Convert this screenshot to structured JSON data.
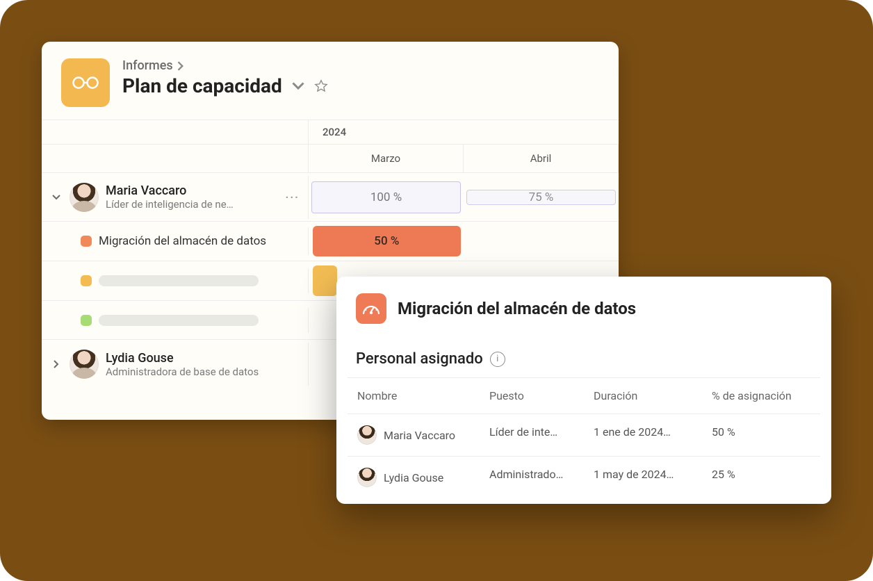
{
  "header": {
    "breadcrumb": "Informes",
    "title": "Plan de capacidad",
    "year": "2024",
    "months": [
      "Marzo",
      "Abril"
    ]
  },
  "people": [
    {
      "name": "Maria Vaccaro",
      "role": "Líder de inteligencia de ne…",
      "expanded": true,
      "allocations": [
        "100 %",
        "75 %"
      ],
      "tasks": [
        {
          "swatch": "orange",
          "name": "Migración del almacén de datos",
          "bar": {
            "color": "orange",
            "value": "50 %",
            "span": 1
          }
        },
        {
          "swatch": "amber",
          "name_placeholder": true,
          "bar": {
            "color": "amber",
            "value": "",
            "span": 0.15
          }
        },
        {
          "swatch": "green",
          "name_placeholder": true
        }
      ]
    },
    {
      "name": "Lydia Gouse",
      "role": "Administradora de base de datos",
      "expanded": false
    }
  ],
  "detail": {
    "title": "Migración del almacén de datos",
    "section": "Personal asignado",
    "columns": [
      "Nombre",
      "Puesto",
      "Duración",
      "% de asignación"
    ],
    "rows": [
      {
        "name": "Maria Vaccaro",
        "role": "Líder de inte…",
        "duration": "1 ene de 2024…",
        "pct": "50 %"
      },
      {
        "name": "Lydia Gouse",
        "role": "Administrado…",
        "duration": "1 may de 2024…",
        "pct": "25 %"
      }
    ]
  }
}
